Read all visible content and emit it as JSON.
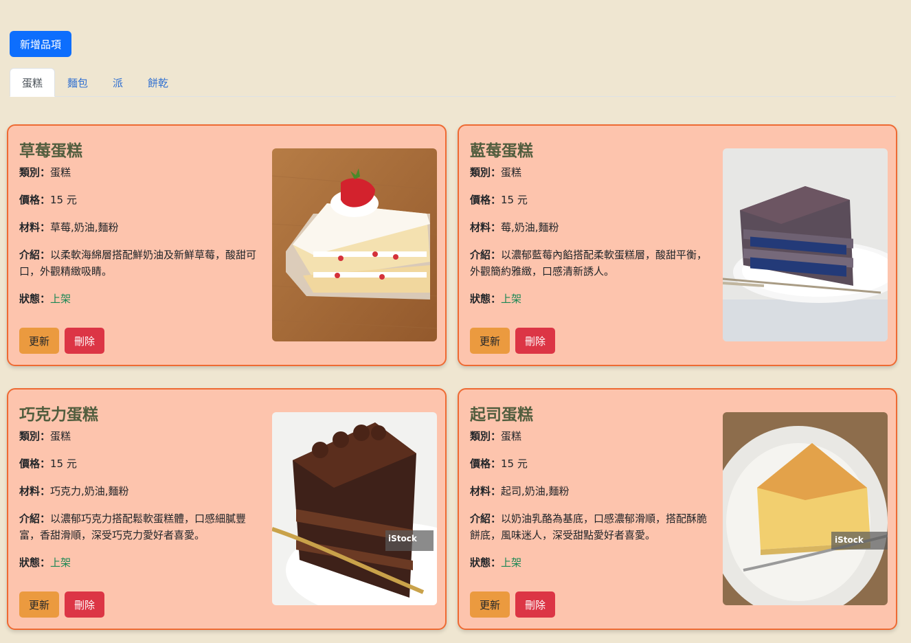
{
  "toolbar": {
    "add_label": "新增品項"
  },
  "tabs": [
    {
      "label": "蛋糕",
      "active": true
    },
    {
      "label": "麵包",
      "active": false
    },
    {
      "label": "派",
      "active": false
    },
    {
      "label": "餅乾",
      "active": false
    }
  ],
  "labels": {
    "category": "類別：",
    "price": "價格：",
    "ingredients": "材料：",
    "intro": "介紹：",
    "status": "狀態："
  },
  "buttons": {
    "update": "更新",
    "delete": "刪除"
  },
  "cards": [
    {
      "title": "草莓蛋糕",
      "category": "蛋糕",
      "price": "15 元",
      "ingredients": "草莓,奶油,麵粉",
      "intro": "以柔軟海綿層搭配鮮奶油及新鮮草莓，酸甜可口，外觀精緻吸睛。",
      "status": "上架",
      "image_icon": "strawberry-cake-photo"
    },
    {
      "title": "藍莓蛋糕",
      "category": "蛋糕",
      "price": "15 元",
      "ingredients": "莓,奶油,麵粉",
      "intro": "以濃郁藍莓內餡搭配柔軟蛋糕層，酸甜平衡，外觀簡約雅緻，口感清新誘人。",
      "status": "上架",
      "image_icon": "blueberry-cake-photo"
    },
    {
      "title": "巧克力蛋糕",
      "category": "蛋糕",
      "price": "15 元",
      "ingredients": "巧克力,奶油,麵粉",
      "intro": "以濃郁巧克力搭配鬆軟蛋糕體，口感細膩豐富，香甜滑順，深受巧克力愛好者喜愛。",
      "status": "上架",
      "image_icon": "chocolate-cake-photo",
      "watermark": "iStock"
    },
    {
      "title": "起司蛋糕",
      "category": "蛋糕",
      "price": "15 元",
      "ingredients": "起司,奶油,麵粉",
      "intro": "以奶油乳酪為基底，口感濃郁滑順，搭配酥脆餅底，風味迷人，深受甜點愛好者喜愛。",
      "status": "上架",
      "image_icon": "cheesecake-photo",
      "watermark": "iStock"
    }
  ],
  "colors": {
    "page_bg": "#efe6d1",
    "card_bg": "#fdc4ad",
    "card_border": "#ee6a32",
    "primary": "#0d6efd",
    "update": "#eb9a3f",
    "delete": "#dc3545",
    "status_active": "#198754"
  }
}
